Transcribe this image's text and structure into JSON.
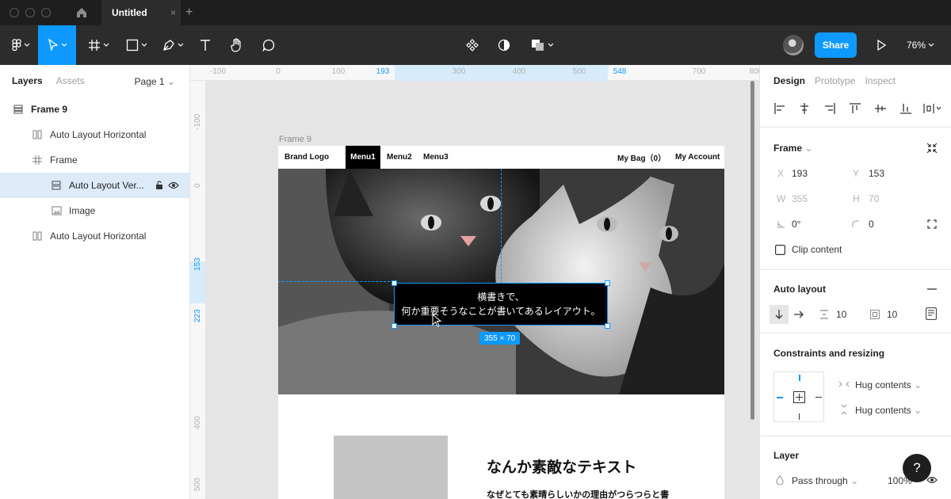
{
  "window": {
    "tab_title": "Untitled",
    "tab_close": "×",
    "new_tab": "+"
  },
  "toolbar": {
    "share_label": "Share",
    "zoom": "76%",
    "tools": [
      "figma-menu-icon",
      "move-tool-icon",
      "frame-tool-icon",
      "shape-tool-icon",
      "pen-tool-icon",
      "text-tool-icon",
      "hand-tool-icon",
      "comment-tool-icon",
      "component-icon",
      "mask-icon",
      "boolean-icon",
      "play-icon"
    ]
  },
  "layers_panel": {
    "tabs": {
      "layers": "Layers",
      "assets": "Assets"
    },
    "page": "Page 1",
    "items": [
      {
        "label": "Frame 9",
        "icon": "frame-rows-icon"
      },
      {
        "label": "Auto Layout Horizontal",
        "icon": "columns-icon"
      },
      {
        "label": "Frame",
        "icon": "hash-icon"
      },
      {
        "label": "Auto Layout Ver...",
        "icon": "rows-icon",
        "selected": true
      },
      {
        "label": "Image",
        "icon": "image-icon"
      },
      {
        "label": "Auto Layout Horizontal",
        "icon": "columns-icon"
      }
    ]
  },
  "canvas": {
    "ruler_top": [
      "-100",
      "0",
      "100",
      "193",
      "300",
      "400",
      "500",
      "548",
      "700",
      "800"
    ],
    "ruler_left": [
      "-100",
      "0",
      "153",
      "223",
      "400",
      "500"
    ],
    "frame_label": "Frame 9",
    "nav": {
      "brand": "Brand Logo",
      "menu1": "Menu1",
      "menu2": "Menu2",
      "menu3": "Menu3",
      "bag": "My Bag（0）",
      "account": "My Account"
    },
    "caption_line1": "横書きで、",
    "caption_line2": "何か重要そうなことが書いてあるレイアウト。",
    "size_badge": "355 × 70",
    "heading": "なんか素敵なテキスト",
    "subtext": "なぜとても素晴らしいかの理由がつらつらと書"
  },
  "design_panel": {
    "tabs": {
      "design": "Design",
      "prototype": "Prototype",
      "inspect": "Inspect"
    },
    "frame_section": "Frame",
    "x_label": "X",
    "x": "193",
    "y_label": "Y",
    "y": "153",
    "w_label": "W",
    "w": "355",
    "h_label": "H",
    "h": "70",
    "rotation": "0°",
    "radius": "0",
    "clip_content": "Clip content",
    "auto_layout": "Auto layout",
    "spacing": "10",
    "padding": "10",
    "constraints": "Constraints and resizing",
    "hug_h": "Hug contents",
    "hug_v": "Hug contents",
    "layer": "Layer",
    "blend": "Pass through",
    "opacity": "100%",
    "help": "?"
  },
  "colors": {
    "accent": "#0d99ff",
    "toolbar": "#2c2c2c",
    "titlebar": "#1e1e1e",
    "selection": "#dcebf7"
  }
}
